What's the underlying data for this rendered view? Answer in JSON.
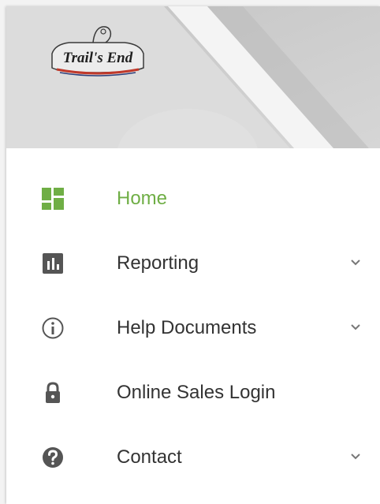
{
  "brand": {
    "logo_text": "Trail's End"
  },
  "colors": {
    "accent": "#6fae45",
    "icon_gray": "#555555",
    "text": "#333333",
    "banner_gray": "#cfcfcf"
  },
  "nav": {
    "items": [
      {
        "label": "Home",
        "icon": "dashboard-grid-icon",
        "active": true,
        "expandable": false
      },
      {
        "label": "Reporting",
        "icon": "bar-chart-icon",
        "active": false,
        "expandable": true
      },
      {
        "label": "Help Documents",
        "icon": "info-icon",
        "active": false,
        "expandable": true
      },
      {
        "label": "Online Sales Login",
        "icon": "lock-icon",
        "active": false,
        "expandable": false
      },
      {
        "label": "Contact",
        "icon": "question-icon",
        "active": false,
        "expandable": true
      }
    ]
  }
}
